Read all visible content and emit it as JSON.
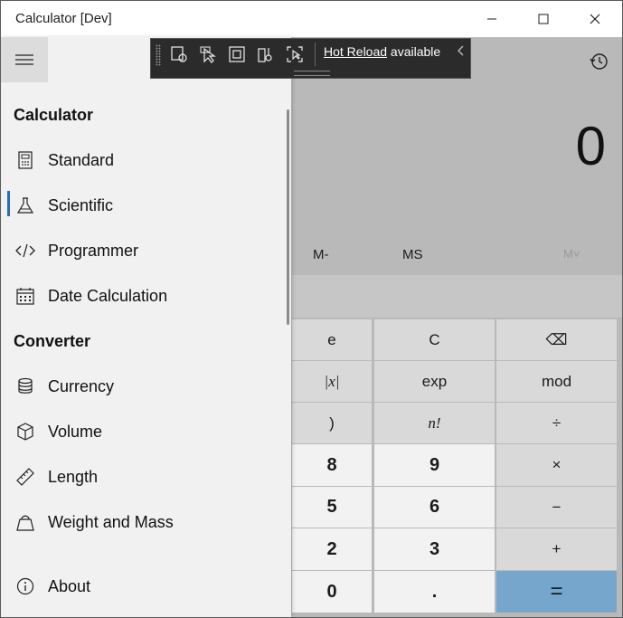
{
  "window": {
    "title": "Calculator [Dev]"
  },
  "calculator": {
    "display": "0",
    "memory": {
      "m_minus": "M-",
      "ms": "MS",
      "m_list": "M˅"
    },
    "keys": [
      {
        "label": "e",
        "type": "op"
      },
      {
        "label": "C",
        "type": "op"
      },
      {
        "label": "⌫",
        "type": "op"
      },
      {
        "label": "|x|",
        "type": "op"
      },
      {
        "label": "exp",
        "type": "op"
      },
      {
        "label": "mod",
        "type": "op"
      },
      {
        "label": ")",
        "type": "op"
      },
      {
        "label": "n!",
        "type": "op"
      },
      {
        "label": "÷",
        "type": "op"
      },
      {
        "label": "8",
        "type": "num"
      },
      {
        "label": "9",
        "type": "num"
      },
      {
        "label": "×",
        "type": "op"
      },
      {
        "label": "5",
        "type": "num"
      },
      {
        "label": "6",
        "type": "num"
      },
      {
        "label": "−",
        "type": "op"
      },
      {
        "label": "2",
        "type": "num"
      },
      {
        "label": "3",
        "type": "num"
      },
      {
        "label": "+",
        "type": "op"
      },
      {
        "label": "0",
        "type": "num"
      },
      {
        "label": ".",
        "type": "num"
      },
      {
        "label": "=",
        "type": "eq"
      }
    ]
  },
  "nav": {
    "calculator_header": "Calculator",
    "converter_header": "Converter",
    "items": [
      {
        "label": "Standard",
        "icon": "calculator-icon"
      },
      {
        "label": "Scientific",
        "icon": "flask-icon"
      },
      {
        "label": "Programmer",
        "icon": "code-icon"
      },
      {
        "label": "Date Calculation",
        "icon": "calendar-icon"
      },
      {
        "label": "Currency",
        "icon": "coins-icon"
      },
      {
        "label": "Volume",
        "icon": "cube-icon"
      },
      {
        "label": "Length",
        "icon": "ruler-icon"
      },
      {
        "label": "Weight and Mass",
        "icon": "weight-icon"
      },
      {
        "label": "About",
        "icon": "info-icon"
      }
    ],
    "selected": "Scientific"
  },
  "devbar": {
    "hot_reload_link": "Hot Reload",
    "hot_reload_suffix": " available"
  },
  "colors": {
    "accent": "#2a6fb6",
    "equals_key": "#77a6cd"
  }
}
